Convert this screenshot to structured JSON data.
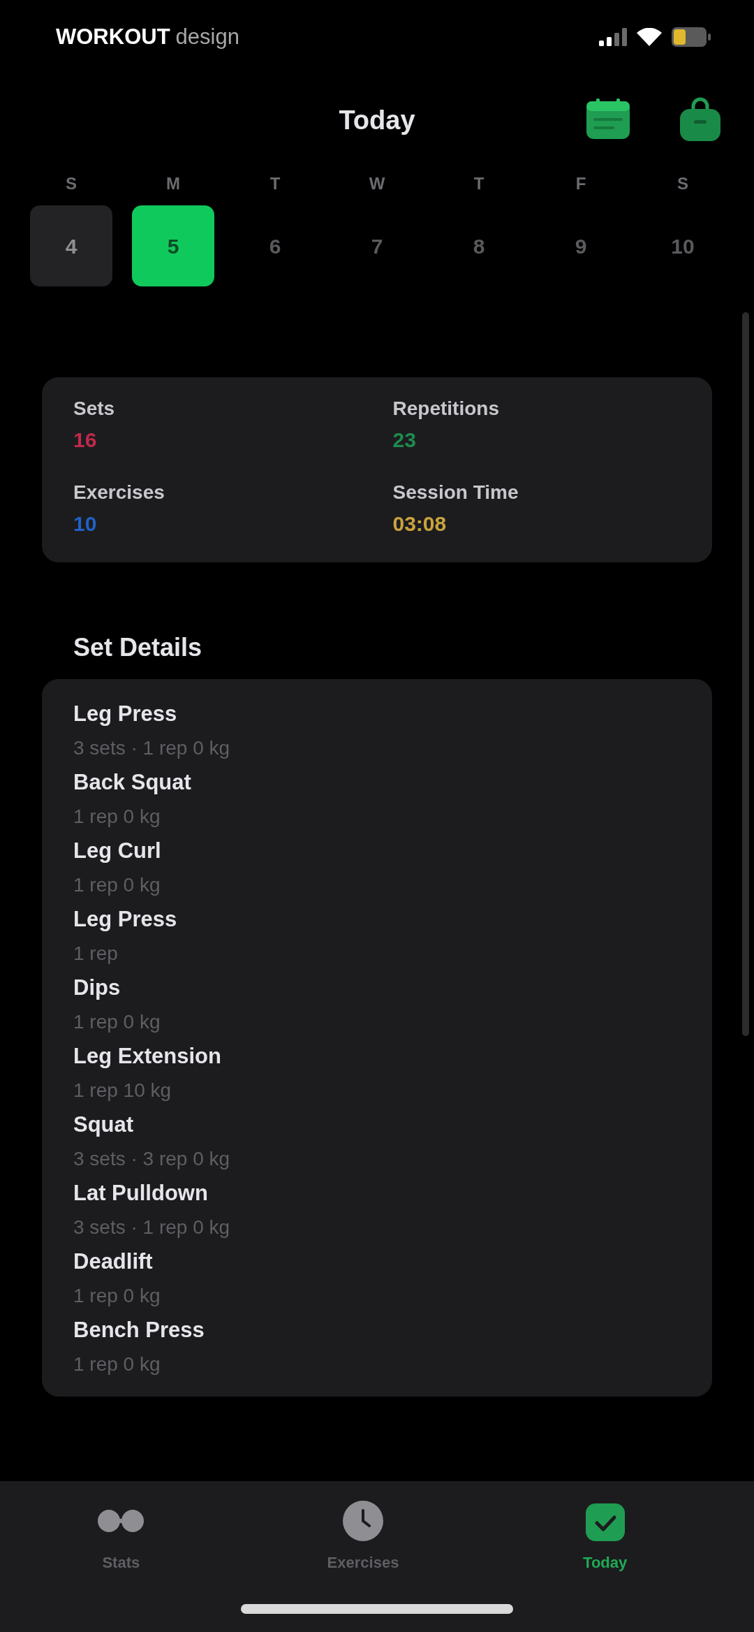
{
  "status_bar": {
    "title": "WORKOUT",
    "subtitle": "design"
  },
  "header": {
    "title": "Today"
  },
  "week": [
    {
      "weekday": "S",
      "date": "4",
      "selected": false,
      "has_activity": true
    },
    {
      "weekday": "M",
      "date": "5",
      "selected": true,
      "has_activity": false
    },
    {
      "weekday": "T",
      "date": "6",
      "selected": false,
      "has_activity": false
    },
    {
      "weekday": "W",
      "date": "7",
      "selected": false,
      "has_activity": false
    },
    {
      "weekday": "T",
      "date": "8",
      "selected": false,
      "has_activity": false
    },
    {
      "weekday": "F",
      "date": "9",
      "selected": false,
      "has_activity": false
    },
    {
      "weekday": "S",
      "date": "10",
      "selected": false,
      "has_activity": false
    }
  ],
  "stats": [
    {
      "label": "Sets",
      "value": "16",
      "color": "#c0294a"
    },
    {
      "label": "Repetitions",
      "value": "23",
      "color": "#1e8a4c"
    },
    {
      "label": "Exercises",
      "value": "10",
      "color": "#2160c4"
    },
    {
      "label": "Session Time",
      "value": "03:08",
      "color": "#c9a43c"
    }
  ],
  "set_details": {
    "title": "Set Details",
    "exercises": [
      {
        "name": "Leg Press",
        "detail": "3 sets · 1 rep 0 kg"
      },
      {
        "name": "Back Squat",
        "detail": "1 rep 0 kg"
      },
      {
        "name": "Leg Curl",
        "detail": "1 rep 0 kg"
      },
      {
        "name": "Leg Press",
        "detail": "1 rep"
      },
      {
        "name": "Dips",
        "detail": "1 rep 0 kg"
      },
      {
        "name": "Leg Extension",
        "detail": "1 rep 10 kg"
      },
      {
        "name": "Squat",
        "detail": "3 sets · 3 rep 0 kg"
      },
      {
        "name": "Lat Pulldown",
        "detail": "3 sets · 1 rep 0 kg"
      },
      {
        "name": "Deadlift",
        "detail": "1 rep 0 kg"
      },
      {
        "name": "Bench Press",
        "detail": "1 rep 0 kg"
      }
    ]
  },
  "tab_bar": [
    {
      "label": "Stats",
      "selected": false
    },
    {
      "label": "Exercises",
      "selected": false
    },
    {
      "label": "Today",
      "selected": true
    }
  ]
}
